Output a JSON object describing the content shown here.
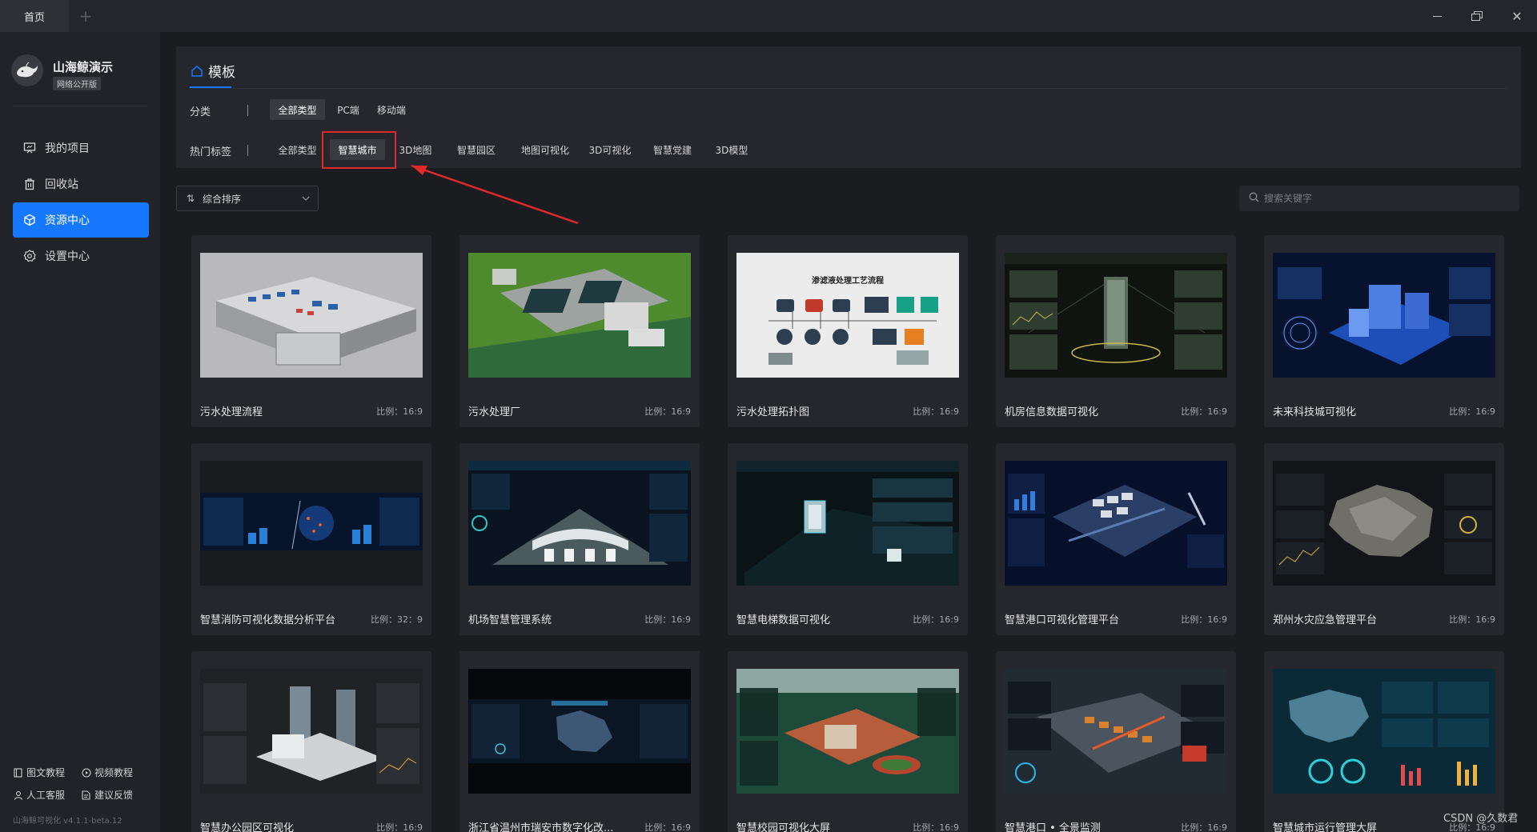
{
  "titlebar": {
    "tab_home": "首页",
    "add_tab_icon": "plus-icon",
    "minimize_icon": "minimize-icon",
    "maximize_icon": "restore-icon",
    "close_icon": "close-icon"
  },
  "sidebar": {
    "app_name": "山海鲸演示",
    "app_badge": "网络公开版",
    "items": [
      {
        "label": "我的项目",
        "icon": "project-icon",
        "active": false
      },
      {
        "label": "回收站",
        "icon": "trash-icon",
        "active": false
      },
      {
        "label": "资源中心",
        "icon": "cube-icon",
        "active": true
      },
      {
        "label": "设置中心",
        "icon": "gear-icon",
        "active": false
      }
    ],
    "footer": {
      "doc_tutorial": "图文教程",
      "video_tutorial": "视频教程",
      "support": "人工客服",
      "feedback": "建议反馈"
    },
    "version": "山海鲸可视化 v4.1.1-beta.12"
  },
  "header": {
    "title": "模板",
    "category_label": "分类",
    "categories": [
      "全部类型",
      "PC端",
      "移动端"
    ],
    "active_category": "全部类型",
    "hot_tags_label": "热门标签",
    "tags": [
      "全部类型",
      "智慧城市",
      "3D地图",
      "智慧园区",
      "地图可视化",
      "3D可视化",
      "智慧党建",
      "3D模型"
    ],
    "active_tag": "智慧城市"
  },
  "toolbar": {
    "sort_label": "综合排序",
    "search_placeholder": "搜索关键字"
  },
  "templates": [
    {
      "name": "污水处理流程",
      "ratio": "比例：16:9"
    },
    {
      "name": "污水处理厂",
      "ratio": "比例：16:9"
    },
    {
      "name": "污水处理拓扑图",
      "ratio": "比例：16:9"
    },
    {
      "name": "机房信息数据可视化",
      "ratio": "比例：16:9"
    },
    {
      "name": "未来科技城可视化",
      "ratio": "比例：16:9"
    },
    {
      "name": "智慧消防可视化数据分析平台",
      "ratio": "比例：32：9"
    },
    {
      "name": "机场智慧管理系统",
      "ratio": "比例：16:9"
    },
    {
      "name": "智慧电梯数据可视化",
      "ratio": "比例：16:9"
    },
    {
      "name": "智慧港口可视化管理平台",
      "ratio": "比例：16:9"
    },
    {
      "name": "郑州水灾应急管理平台",
      "ratio": "比例：16:9"
    },
    {
      "name": "智慧办公园区可视化",
      "ratio": "比例：16:9"
    },
    {
      "name": "浙江省温州市瑞安市数字化改...",
      "ratio": "比例：16:9"
    },
    {
      "name": "智慧校园可视化大屏",
      "ratio": "比例：16:9"
    },
    {
      "name": "智慧港口 • 全景监测",
      "ratio": "比例：16:9"
    },
    {
      "name": "智慧城市运行管理大屏",
      "ratio": "比例：16:9"
    }
  ],
  "thumb_text": {
    "wastewater_topology_title": "渗滤液处理工艺流程"
  },
  "watermark": "CSDN @久数君",
  "colors": {
    "accent": "#1677ff",
    "highlight": "#e02a2a",
    "panel": "#26272c",
    "background": "#1b1c20"
  }
}
